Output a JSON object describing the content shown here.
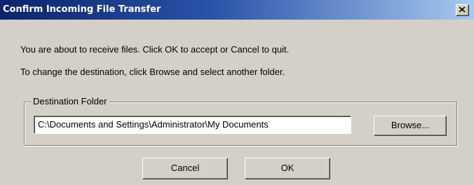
{
  "window": {
    "title": "Confirm Incoming File Transfer",
    "close_icon": "close-icon"
  },
  "messages": {
    "line1": "You are about to receive files. Click OK to accept or Cancel to quit.",
    "line2": "To change the destination, click Browse and select another folder."
  },
  "destination": {
    "group_label": "Destination Folder",
    "path_value": "C:\\Documents and Settings\\Administrator\\My Documents",
    "browse_label": "Browse..."
  },
  "buttons": {
    "cancel_label": "Cancel",
    "ok_label": "OK"
  },
  "colors": {
    "titlebar_start": "#0a246a",
    "titlebar_end": "#a6caf0",
    "face": "#d4d0c8"
  }
}
